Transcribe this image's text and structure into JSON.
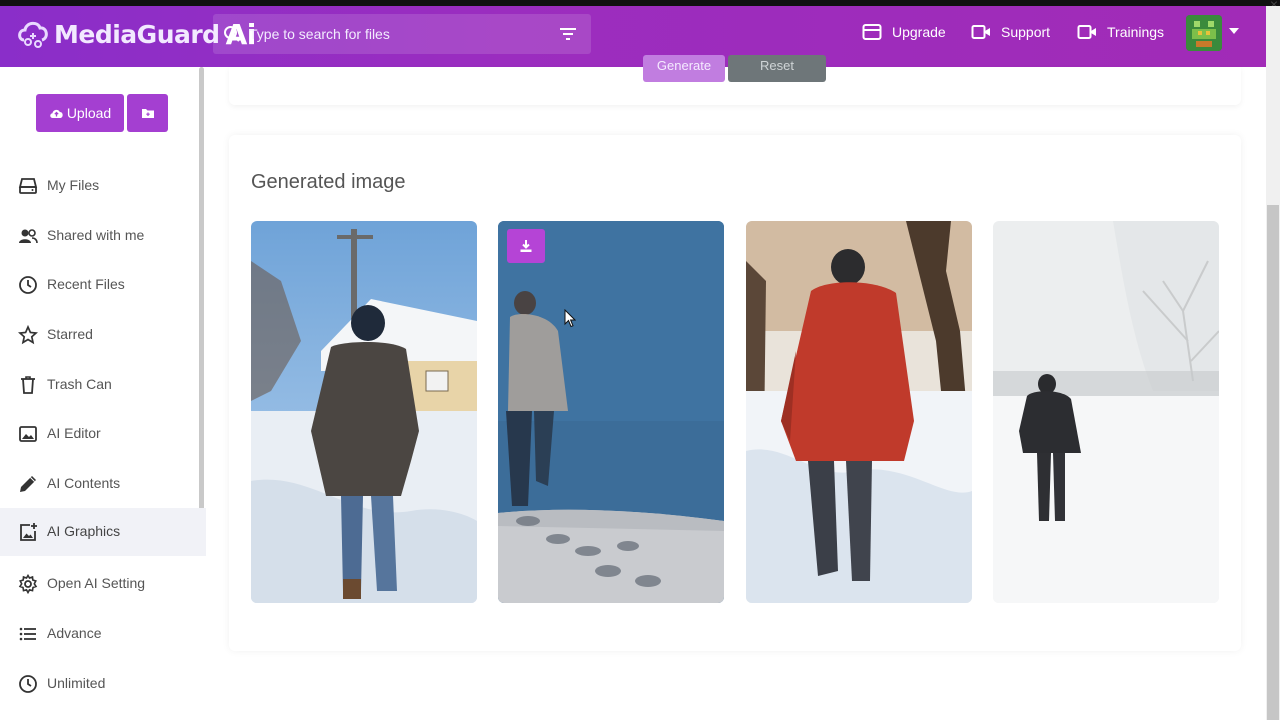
{
  "app": {
    "brand_name": "MediaGuard",
    "brand_suffix": "Ai"
  },
  "search": {
    "placeholder": "Type to search for files"
  },
  "header_nav": [
    {
      "label": "Upgrade",
      "icon": "card-icon"
    },
    {
      "label": "Support",
      "icon": "video-camera-icon"
    },
    {
      "label": "Trainings",
      "icon": "video-camera-icon"
    }
  ],
  "sidebar": {
    "upload_label": "Upload",
    "items": [
      {
        "label": "My Files",
        "icon": "drive-icon"
      },
      {
        "label": "Shared with me",
        "icon": "users-icon"
      },
      {
        "label": "Recent Files",
        "icon": "clock-icon"
      },
      {
        "label": "Starred",
        "icon": "star-icon"
      },
      {
        "label": "Trash Can",
        "icon": "trash-icon"
      },
      {
        "label": "AI Editor",
        "icon": "image-icon"
      },
      {
        "label": "AI Contents",
        "icon": "pencil-icon"
      },
      {
        "label": "AI Graphics",
        "icon": "image-plus-icon",
        "active": true
      },
      {
        "label": "Open AI Setting",
        "icon": "gear-icon"
      },
      {
        "label": "Advance",
        "icon": "list-icon"
      },
      {
        "label": "Unlimited",
        "icon": "clock-icon"
      }
    ]
  },
  "toolbar": {
    "generate_label": "Generate",
    "reset_label": "Reset"
  },
  "generated": {
    "title": "Generated image",
    "images": [
      "man-in-brown-coat-walking-snow-by-house",
      "blurred-man-walking-on-blue-background",
      "man-in-red-coat-walking-snowy-path",
      "man-in-black-walking-snowy-field"
    ]
  },
  "colors": {
    "brand_purple": "#9b2dbf",
    "button_purple": "#a43fd1",
    "reset_gray": "#6e7679"
  }
}
